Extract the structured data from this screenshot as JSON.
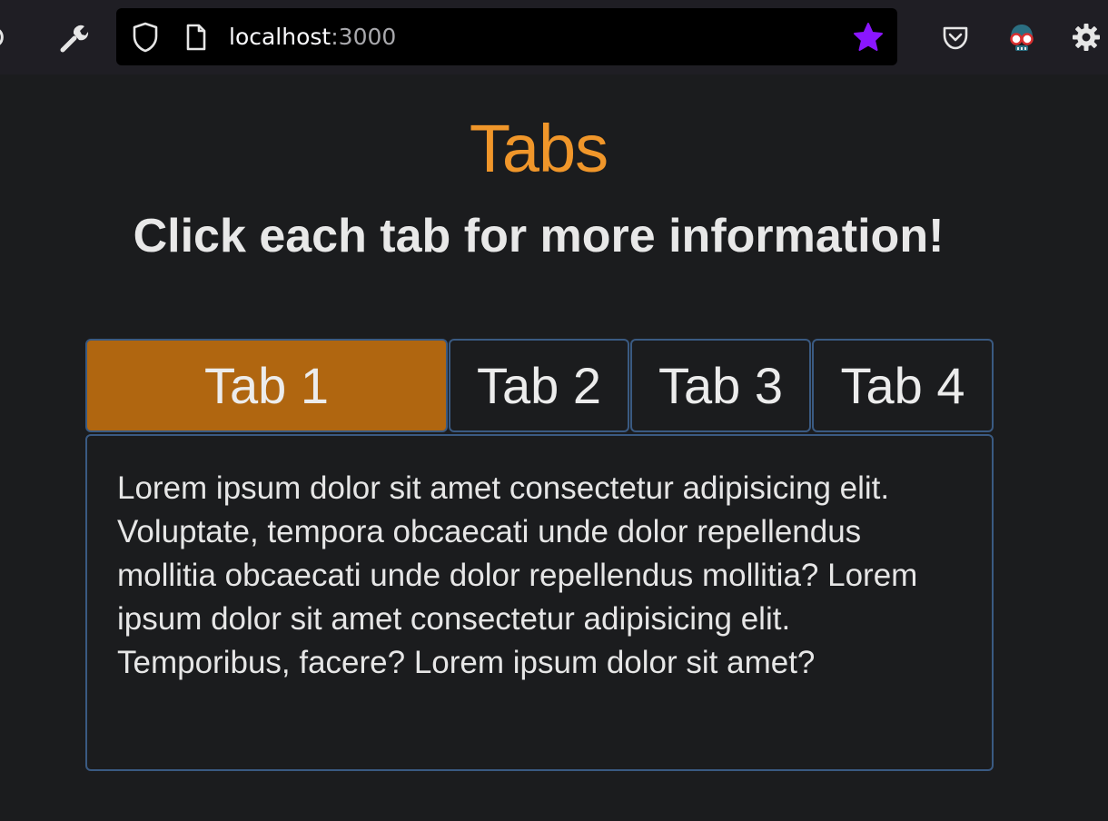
{
  "browser": {
    "url_host": "localhost",
    "url_port": ":3000",
    "icons": [
      "reload-icon",
      "wrench-icon",
      "shield-icon",
      "page-icon",
      "bookmark-star-icon",
      "pocket-icon",
      "extension-icon",
      "settings-gear-icon"
    ],
    "star_color": "#8a16ff"
  },
  "page": {
    "title": "Tabs",
    "subtitle": "Click each tab for more information!",
    "accent_color": "#f0962a",
    "active_tab_color": "#b06610",
    "border_color": "#3a5a82"
  },
  "tabs": [
    {
      "label": "Tab 1",
      "active": true
    },
    {
      "label": "Tab 2",
      "active": false
    },
    {
      "label": "Tab 3",
      "active": false
    },
    {
      "label": "Tab 4",
      "active": false
    }
  ],
  "panel": {
    "text": "Lorem ipsum dolor sit amet consectetur adipisicing elit. Voluptate, tempora obcaecati unde dolor repellendus mollitia obcaecati unde dolor repellendus mollitia? Lorem ipsum dolor sit amet consectetur adipisicing elit. Temporibus, facere? Lorem ipsum dolor sit amet?"
  }
}
